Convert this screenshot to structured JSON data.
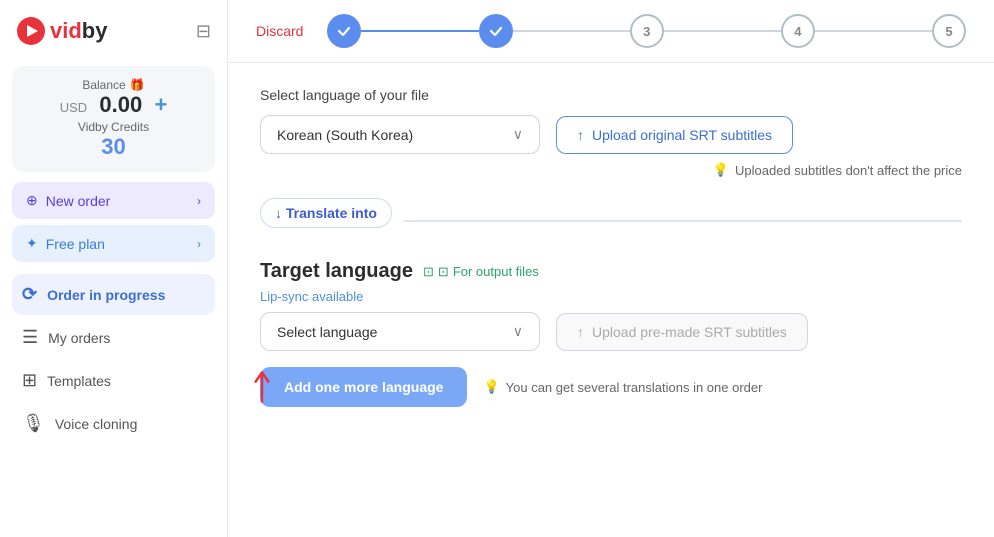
{
  "logo": {
    "icon_alt": "vidby logo icon",
    "text_pre": "vid",
    "text_post": "by"
  },
  "sidebar": {
    "balance_label": "Balance",
    "balance_gift_icon": "🎁",
    "balance_usd_prefix": "USD",
    "balance_amount": "0.00",
    "balance_plus": "+",
    "credits_label": "Vidby Credits",
    "credits_amount": "30",
    "new_order_label": "New order",
    "free_plan_label": "Free plan",
    "nav_items": [
      {
        "id": "order-in-progress",
        "label": "Order in progress",
        "icon": "🔄",
        "active": true
      },
      {
        "id": "my-orders",
        "label": "My orders",
        "icon": "☰",
        "active": false
      },
      {
        "id": "templates",
        "label": "Templates",
        "icon": "⊞",
        "active": false
      },
      {
        "id": "voice-cloning",
        "label": "Voice cloning",
        "icon": "🎙",
        "active": false
      }
    ]
  },
  "topbar": {
    "discard_label": "Discard",
    "steps": [
      {
        "id": 1,
        "state": "done",
        "label": "✓"
      },
      {
        "id": 2,
        "state": "done",
        "label": "✓"
      },
      {
        "id": 3,
        "state": "current",
        "label": "3"
      },
      {
        "id": 4,
        "state": "current",
        "label": "4"
      },
      {
        "id": 5,
        "state": "current",
        "label": "5"
      }
    ]
  },
  "content": {
    "file_language_label": "Select language of your file",
    "file_language_value": "Korean (South Korea)",
    "upload_srt_label": "Upload original SRT subtitles",
    "upload_hint": "Uploaded subtitles don't affect the price",
    "translate_into_label": "↓ Translate into",
    "target_language_title": "Target language",
    "for_output_label": "For output files",
    "lip_sync_label": "Lip-sync available",
    "select_language_placeholder": "Select language",
    "upload_premade_label": "Upload pre-made SRT subtitles",
    "add_language_label": "Add one more language",
    "you_can_hint": "You can get several translations in one order"
  }
}
